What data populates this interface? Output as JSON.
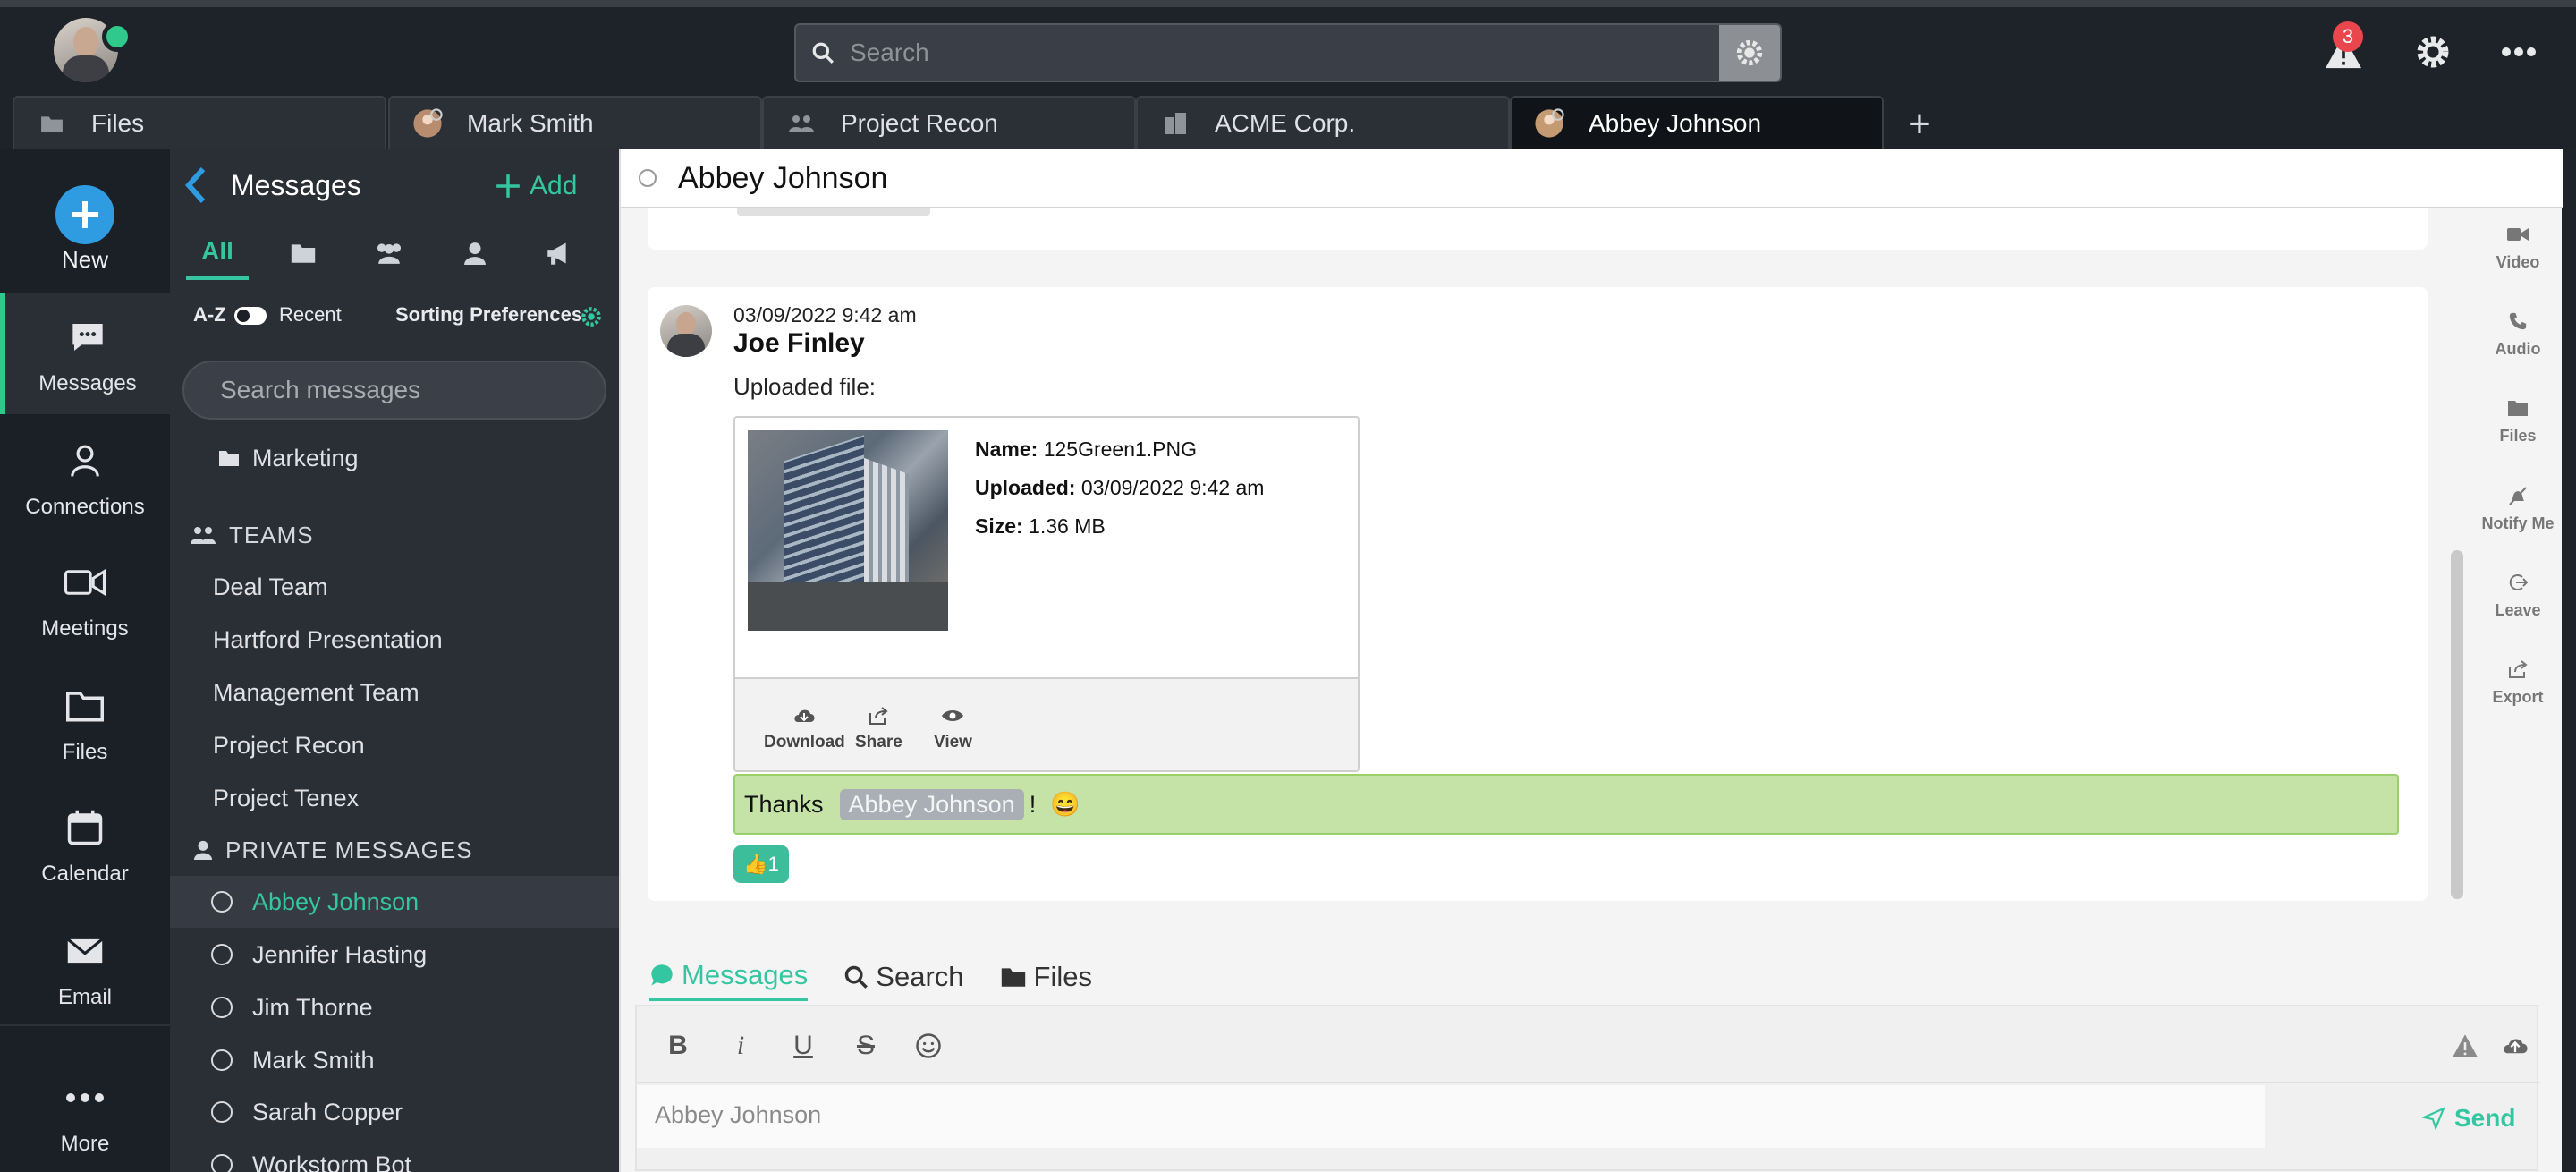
{
  "topbar": {
    "search_placeholder": "Search",
    "notification_count": "3"
  },
  "tabs": [
    {
      "label": "Files",
      "icon": "folder-icon"
    },
    {
      "label": "Mark Smith",
      "icon": "user-avatar-icon"
    },
    {
      "label": "Project Recon",
      "icon": "team-icon"
    },
    {
      "label": "ACME Corp.",
      "icon": "building-icon"
    },
    {
      "label": "Abbey Johnson",
      "icon": "user-avatar-icon"
    }
  ],
  "leftnav": {
    "new_label": "New",
    "items": [
      {
        "label": "Messages",
        "icon": "chat-icon"
      },
      {
        "label": "Connections",
        "icon": "person-icon"
      },
      {
        "label": "Meetings",
        "icon": "video-icon"
      },
      {
        "label": "Files",
        "icon": "folder-icon"
      },
      {
        "label": "Calendar",
        "icon": "calendar-icon"
      },
      {
        "label": "Email",
        "icon": "envelope-icon"
      },
      {
        "label": "More",
        "icon": "ellipsis-icon"
      }
    ]
  },
  "sidebar": {
    "title": "Messages",
    "add_label": "Add",
    "filters": [
      "All"
    ],
    "sort": {
      "az": "A-Z",
      "recent": "Recent",
      "preferences": "Sorting Preferences"
    },
    "search_placeholder": "Search messages",
    "folder_item": "Marketing",
    "teams_header": "TEAMS",
    "teams": [
      "Deal Team",
      "Hartford Presentation",
      "Management Team",
      "Project Recon",
      "Project Tenex"
    ],
    "private_header": "PRIVATE MESSAGES",
    "private": [
      "Abbey Johnson",
      "Jennifer Hasting",
      "Jim Thorne",
      "Mark Smith",
      "Sarah Copper",
      "Workstorm Bot"
    ]
  },
  "chat": {
    "title": "Abbey Johnson",
    "message": {
      "timestamp": "03/09/2022 9:42 am",
      "author": "Joe Finley",
      "text": "Uploaded file:",
      "file": {
        "name_label": "Name:",
        "name": "125Green1.PNG",
        "uploaded_label": "Uploaded:",
        "uploaded": "03/09/2022 9:42 am",
        "size_label": "Size:",
        "size": "1.36 MB",
        "actions": {
          "download": "Download",
          "share": "Share",
          "view": "View"
        }
      }
    },
    "reply": {
      "prefix": "Thanks",
      "mention": "Abbey Johnson",
      "suffix": "!",
      "emoji": "😄"
    },
    "reaction": {
      "emoji": "👍",
      "count": "1"
    },
    "side_actions": [
      "Video",
      "Audio",
      "Files",
      "Notify Me",
      "Leave",
      "Export"
    ],
    "bottom_tabs": [
      "Messages",
      "Search",
      "Files"
    ],
    "composer_placeholder": "Abbey Johnson",
    "send_label": "Send"
  },
  "colors": {
    "accent": "#34c6a0",
    "presence": "#2fc98c",
    "new_button": "#2f9be0",
    "reply_bg": "#c5e3a6"
  }
}
